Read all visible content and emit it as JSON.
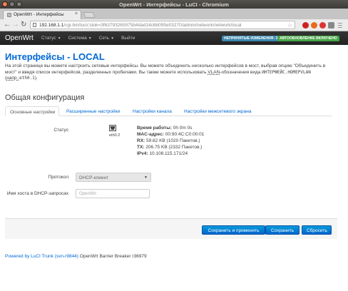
{
  "window": {
    "title": "OpenWrt - Интерфейсы - LuCI - Chromium"
  },
  "browser": {
    "tab_title": "OpenWrt - Интерфейсы",
    "url_host": "192.168.1.1",
    "url_path": "/cgi-bin/luci/;stok=3f63793265975b4dad14c8b095e03270/admin/network/network/local"
  },
  "header": {
    "brand": "OpenWrt",
    "nav": [
      "Статус",
      "Система",
      "Сеть",
      "Выйти"
    ],
    "badge_unsaved": "НЕПРИНЯТЫЕ ИЗМЕНЕНИЯ: 3",
    "badge_autorefresh": "АВТООБНОВЛЕНИЕ ВКЛЮЧЕНО"
  },
  "main": {
    "title": "Интерфейсы - LOCAL",
    "desc_1": "На этой странице вы можете настроить сетевые интерфейсы. Вы можете объединить несколько интерфейсов в мост, выбрав опцию \"Объединить в мост\" и введя список интерфейсов, разделенных пробелами. Вы также можете использовать ",
    "desc_vlan": "VLAN",
    "desc_2": "-обозначения вида ",
    "desc_code1": "ИНТЕРФЕЙС.НОМЕРVLAN",
    "desc_3": " (",
    "desc_example": "напр.:",
    "desc_code2": "eth0.1",
    "desc_4": ").",
    "section_title": "Общая конфигурация",
    "tabs": [
      "Основные настройки",
      "Расширенные настройки",
      "Настройки канала",
      "Настройки межсетевого экрана"
    ],
    "status": {
      "label": "Статус",
      "device": "eth0.2",
      "uptime_k": "Время работы:",
      "uptime_v": " 0h 0m 0s",
      "mac_k": "MAC-адрес:",
      "mac_v": " 00:90:4C:C0:00:01",
      "rx_k": "RX:",
      "rx_v": " 59.62 KB (1020 Пакетов.)",
      "tx_k": "TX:",
      "tx_v": " 206.75 KB (2332 Пакетов.)",
      "ipv4_k": "IPv4:",
      "ipv4_v": " 10.108.115.171/24"
    },
    "protocol": {
      "label": "Протокол",
      "value": "DHCP-клиент"
    },
    "hostname": {
      "label": "Имя хоста в DHCP-запросах",
      "placeholder": "OpenWrt"
    },
    "buttons": {
      "apply": "Сохранить и применить",
      "save": "Сохранить",
      "reset": "Сбросить"
    }
  },
  "footer": {
    "link": "Powered by LuCI Trunk (svn-r9844)",
    "text": " OpenWrt Barrier Breaker r36979"
  },
  "colors": {
    "link_blue": "#0069d6",
    "button_blue": "#0064cd",
    "badge_info": "#3a87ad",
    "badge_success": "#46a546"
  }
}
